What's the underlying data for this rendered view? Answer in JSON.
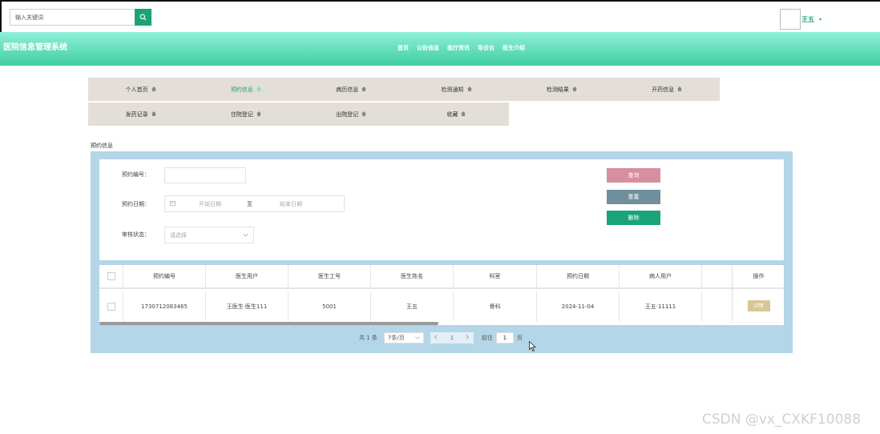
{
  "topbar": {
    "search_placeholder": "输入关键词",
    "user_name": "王五",
    "user_caret": "▾"
  },
  "header": {
    "site_title": "医院信息管理系统",
    "nav": [
      "首页",
      "公告信息",
      "医疗资讯",
      "导诊台",
      "医生介绍"
    ]
  },
  "tabs": {
    "row1": [
      "个人首页",
      "预约信息",
      "病历信息",
      "检测通知",
      "检测结果",
      "开药信息"
    ],
    "row2": [
      "发药记录",
      "住院登记",
      "出院登记",
      "收藏"
    ],
    "active": "预约信息"
  },
  "section_label": "预约信息",
  "filters": {
    "id_label": "预约编号：",
    "date_label": "预约日期：",
    "date_start_placeholder": "开始日期",
    "date_sep": "至",
    "date_end_placeholder": "结束日期",
    "status_label": "审核状态：",
    "status_placeholder": "请选择"
  },
  "buttons": {
    "query": "查询",
    "reset": "重置",
    "delete": "删除"
  },
  "table": {
    "columns": [
      "预约编号",
      "医生用户",
      "医生工号",
      "医生姓名",
      "科室",
      "预约日期",
      "病人用户",
      "",
      "操作"
    ],
    "rows": [
      {
        "id": "1730712083465",
        "doctor_user": "王医生·医生111",
        "doctor_no": "5001",
        "doctor_name": "王五",
        "dept": "骨科",
        "date": "2024-11-04",
        "patient": "王五·11111",
        "action": "详情"
      }
    ]
  },
  "pagination": {
    "total": "共 1 条",
    "page_size": "7条/页",
    "current_page": "1",
    "goto_label": "前往",
    "goto_value": "1",
    "unit": "页"
  },
  "watermark": "CSDN @vx_CXKF10088",
  "colors": {
    "accent": "#1aa37a",
    "query_btn": "#d98e9d",
    "reset_btn": "#6f8f9b",
    "panel_bg": "#b3d6e8",
    "tab_bg": "#e3ded8",
    "detail_btn": "#d8c795"
  }
}
